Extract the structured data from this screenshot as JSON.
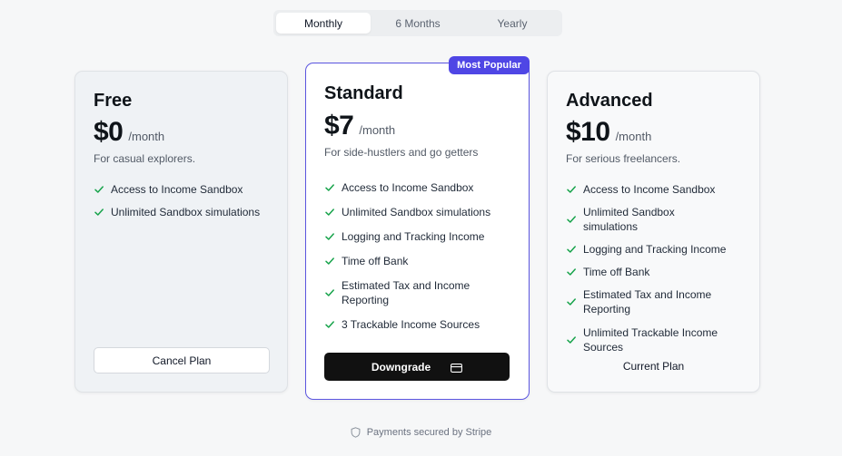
{
  "billing": {
    "options": [
      "Monthly",
      "6 Months",
      "Yearly"
    ],
    "selected": "Monthly"
  },
  "plans": {
    "free": {
      "name": "Free",
      "price": "$0",
      "period": "/month",
      "tagline": "For casual explorers.",
      "features": [
        "Access to Income Sandbox",
        "Unlimited Sandbox simulations"
      ],
      "action_label": "Cancel Plan"
    },
    "standard": {
      "badge": "Most Popular",
      "name": "Standard",
      "price": "$7",
      "period": "/month",
      "tagline": "For side-hustlers and go getters",
      "features": [
        "Access to Income Sandbox",
        "Unlimited Sandbox simulations",
        "Logging and Tracking Income",
        "Time off Bank",
        "Estimated Tax and Income Reporting",
        "3 Trackable Income Sources"
      ],
      "action_label": "Downgrade"
    },
    "advanced": {
      "name": "Advanced",
      "price": "$10",
      "period": "/month",
      "tagline": "For serious freelancers.",
      "features": [
        "Access to Income Sandbox",
        "Unlimited Sandbox simulations",
        "Logging and Tracking Income",
        "Time off Bank",
        "Estimated Tax and Income Reporting",
        "Unlimited Trackable Income Sources"
      ],
      "status_label": "Current Plan"
    }
  },
  "footer": {
    "secure_text": "Payments secured by Stripe"
  },
  "colors": {
    "accent": "#4f46e5",
    "check": "#16a34a",
    "primary_button": "#111111"
  },
  "icons": {
    "check": "check-icon",
    "payment": "credit-card-icon",
    "security": "shield-icon"
  }
}
